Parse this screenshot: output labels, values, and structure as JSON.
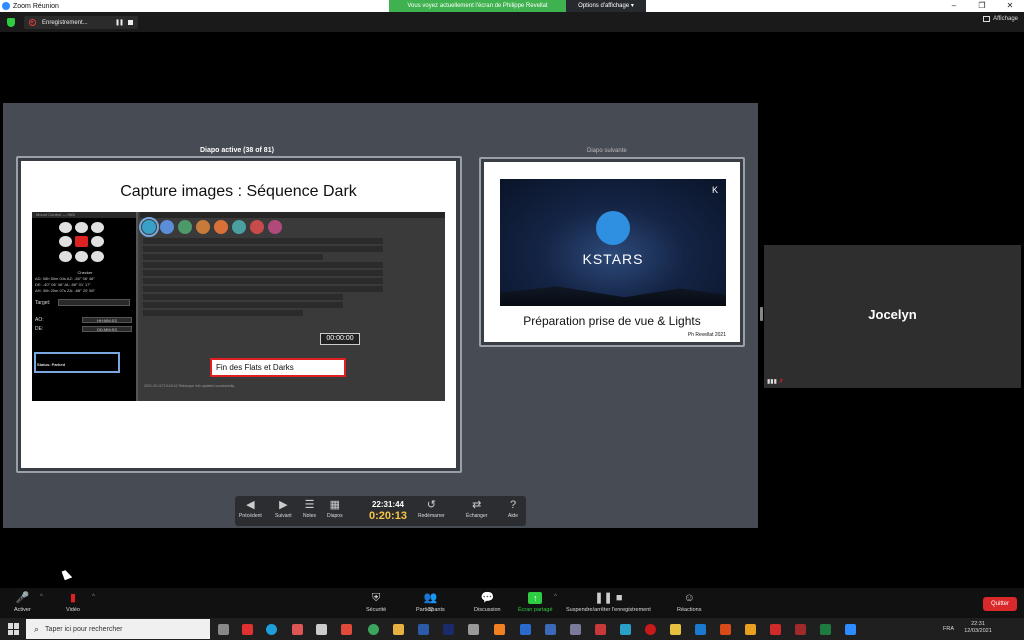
{
  "window": {
    "title": "Zoom Réunion",
    "controls": [
      "–",
      "❐",
      "✕"
    ]
  },
  "share_banner": {
    "text": "Vous voyez actuellement l'écran de Philippe Revellat",
    "view_options": "Options d'affichage ▾"
  },
  "recording": {
    "label": "Enregistrement...",
    "pause_glyph": "❚❚"
  },
  "view_button": "Affichage",
  "presenter": {
    "current_label": "Diapo active (38 of 81)",
    "next_label": "Diapo suivante",
    "current_slide": {
      "title": "Capture images : Séquence Dark",
      "screenshot": {
        "header": "Mount Control — INDI",
        "checker_label": "Checker",
        "coords": [
          "AD: 08h 50m 04s   AZ: -60° 06' 46\"",
          "DE: -40° 06' 46\"   AL: 88° 01' 17\"",
          "AH: 30h 20m 07s   ZA: -88° 20' 58\""
        ],
        "target_label": "Target:",
        "ao_label": "AO:",
        "de_label": "DE:",
        "ao_value": "HH:MM:SS",
        "de_value": "DD:MM:SS",
        "status_label": "Status: Parked",
        "timer": "00:00:00",
        "message": "Fin des Flats et Darks",
        "log": "2021-03-11T19:43:16 Telescope info updated successfully."
      }
    },
    "next_slide": {
      "logo_text": "KSTARS",
      "kde_mark": "K",
      "title": "Préparation prise de vue & Lights",
      "credit": "Ph Revellat 2021"
    },
    "controls": {
      "clock": "22:31:44",
      "elapsed": "0:20:13",
      "buttons": [
        {
          "label": "Précédent",
          "icon": "arrow-left-icon",
          "glyph": "◀"
        },
        {
          "label": "Suivant",
          "icon": "arrow-right-icon",
          "glyph": "▶"
        },
        {
          "label": "Notes",
          "icon": "notes-icon",
          "glyph": "☰"
        },
        {
          "label": "Diapos",
          "icon": "slides-icon",
          "glyph": "▦"
        },
        {
          "label": "Redémarrer",
          "icon": "restart-icon",
          "glyph": "↺"
        },
        {
          "label": "Échanger",
          "icon": "swap-icon",
          "glyph": "⇄"
        },
        {
          "label": "Aide",
          "icon": "help-icon",
          "glyph": "?"
        }
      ]
    }
  },
  "participant_tile": {
    "name": "Jocelyn"
  },
  "meeting_bar": {
    "buttons": [
      {
        "label": "Activer",
        "icon": "mic-muted-icon",
        "glyph": "🎤"
      },
      {
        "label": "Vidéo",
        "icon": "video-off-icon",
        "glyph": "▮"
      },
      {
        "label": "Sécurité",
        "icon": "shield-icon",
        "glyph": "⛨"
      },
      {
        "label": "Participants",
        "icon": "participants-icon",
        "glyph": "👥",
        "count": "22"
      },
      {
        "label": "Discussion",
        "icon": "chat-icon",
        "glyph": "💬"
      },
      {
        "label": "Écran partagé",
        "icon": "share-screen-icon",
        "glyph": "↑"
      },
      {
        "label": "Suspendre/arrêter l'enregistrement",
        "icon": "record-controls-icon",
        "glyph": "❚❚ ■"
      },
      {
        "label": "Réactions",
        "icon": "reactions-icon",
        "glyph": "☺"
      }
    ],
    "quit_label": "Quitter"
  },
  "taskbar": {
    "search_placeholder": "Taper ici pour rechercher",
    "language": "FRA",
    "time": "22:31",
    "date": "12/03/2021"
  },
  "colors": {
    "share_green": "#3fb24f",
    "quit_red": "#d9292b",
    "elapsed_yellow": "#f5c542",
    "stage_gray": "#474b53"
  }
}
